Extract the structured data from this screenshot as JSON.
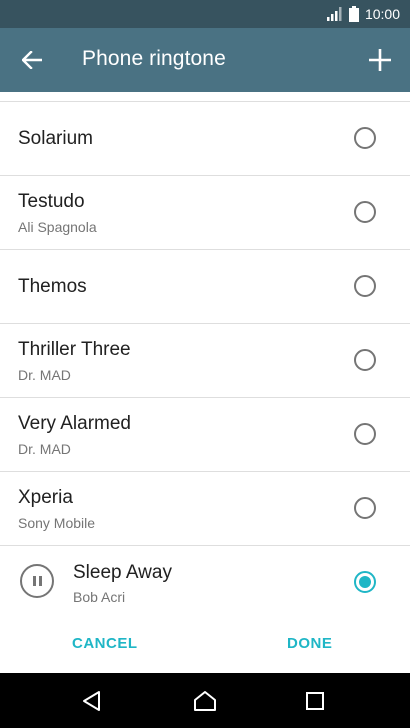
{
  "status_bar": {
    "time": "10:00",
    "icons": [
      "signal-icon",
      "battery-icon"
    ]
  },
  "toolbar": {
    "title": "Phone ringtone",
    "back_icon": "arrow-left-icon",
    "add_icon": "plus-icon"
  },
  "ringtones": [
    {
      "title": "Solarium",
      "subtitle": "",
      "selected": false
    },
    {
      "title": "Testudo",
      "subtitle": "Ali Spagnola",
      "selected": false
    },
    {
      "title": "Themos",
      "subtitle": "",
      "selected": false
    },
    {
      "title": "Thriller Three",
      "subtitle": "Dr. MAD",
      "selected": false
    },
    {
      "title": "Very Alarmed",
      "subtitle": "Dr. MAD",
      "selected": false
    },
    {
      "title": "Xperia",
      "subtitle": "Sony Mobile",
      "selected": false
    }
  ],
  "now_playing": {
    "title": "Sleep Away",
    "subtitle": "Bob Acri",
    "selected": true,
    "icon": "pause-icon"
  },
  "actions": {
    "cancel_label": "CANCEL",
    "done_label": "DONE"
  },
  "nav_bar": {
    "icons": [
      "back-triangle-icon",
      "home-icon",
      "recents-icon"
    ]
  },
  "colors": {
    "status_bar": "#37535f",
    "toolbar": "#4a7283",
    "accent": "#1fb6c6"
  }
}
